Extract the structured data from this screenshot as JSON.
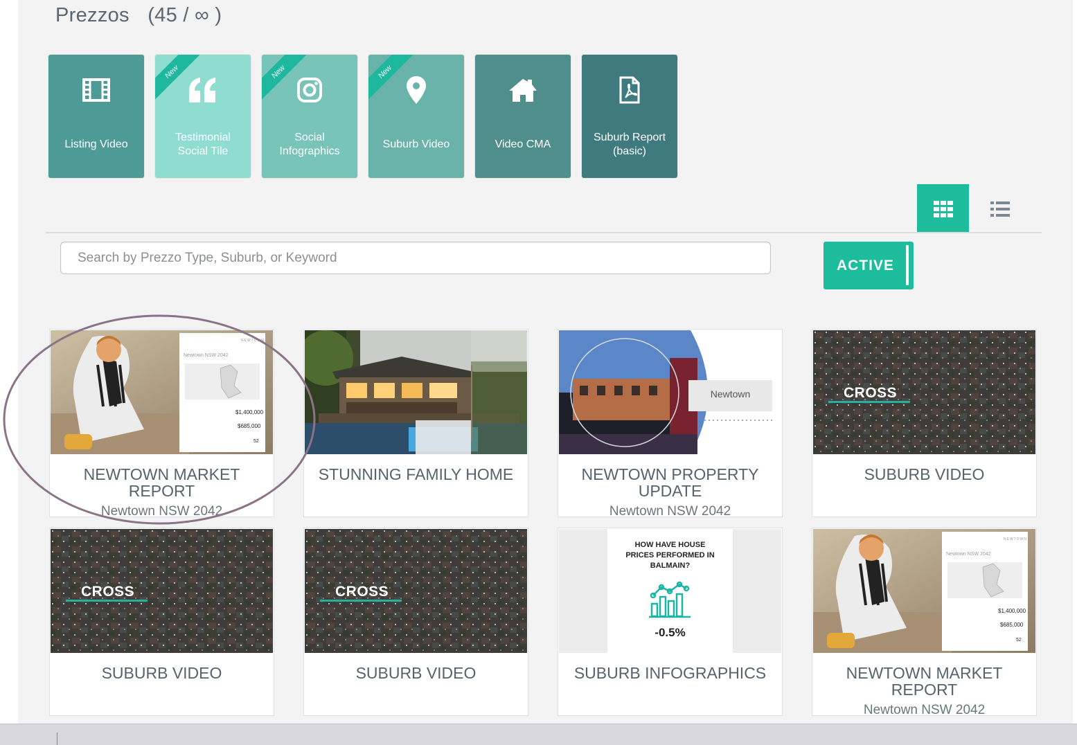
{
  "header": {
    "title": "Prezzos",
    "count": "(45 / ∞ )"
  },
  "create_tiles": [
    {
      "label": "Listing Video",
      "icon": "film-icon",
      "color": "#4e9a97",
      "is_new": false
    },
    {
      "label": "Testimonial Social Tile",
      "icon": "quote-icon",
      "color": "#8fddd1",
      "is_new": true
    },
    {
      "label": "Social Infographics",
      "icon": "instagram-icon",
      "color": "#78c4b9",
      "is_new": true
    },
    {
      "label": "Suburb Video",
      "icon": "map-pin-icon",
      "color": "#69b3ab",
      "is_new": true
    },
    {
      "label": "Video CMA",
      "icon": "home-icon",
      "color": "#4f8e8b",
      "is_new": false
    },
    {
      "label": "Suburb Report (basic)",
      "icon": "pdf-file-icon",
      "color": "#3f7b7e",
      "is_new": false
    }
  ],
  "ribbon_label": "New",
  "view_toggle": {
    "grid": "grid-view-icon",
    "list": "list-view-icon",
    "selected": "grid"
  },
  "search": {
    "placeholder": "Search by Prezzo Type, Suburb, or Keyword",
    "value": ""
  },
  "filter": {
    "label": "ACTIVE"
  },
  "accent_color": "#1cbc9c",
  "cards": [
    {
      "title": "NEWTOWN MARKET REPORT",
      "subtitle": "Newtown NSW 2042",
      "thumb": {
        "type": "market-report",
        "heading": "Newtown NSW 2042",
        "price1": "$1,400,000",
        "price2": "$685,000",
        "num": "52",
        "brand": "NEWTOWN"
      }
    },
    {
      "title": "STUNNING FAMILY HOME",
      "subtitle": "",
      "thumb": {
        "type": "house-photo"
      }
    },
    {
      "title": "NEWTOWN PROPERTY UPDATE",
      "subtitle": "Newtown NSW 2042",
      "thumb": {
        "type": "street-photo",
        "label": "Newtown"
      }
    },
    {
      "title": "SUBURB VIDEO",
      "subtitle": "",
      "thumb": {
        "type": "aerial",
        "label": "CROSS"
      }
    },
    {
      "title": "SUBURB VIDEO",
      "subtitle": "",
      "thumb": {
        "type": "aerial",
        "label": "CROSS"
      }
    },
    {
      "title": "SUBURB VIDEO",
      "subtitle": "",
      "thumb": {
        "type": "aerial",
        "label": "CROSS"
      }
    },
    {
      "title": "SUBURB INFOGRAPHICS",
      "subtitle": "",
      "thumb": {
        "type": "infographic",
        "heading": "HOW HAVE HOUSE PRICES PERFORMED IN BALMAIN?",
        "value": "-0.5%"
      }
    },
    {
      "title": "NEWTOWN MARKET REPORT",
      "subtitle": "Newtown NSW 2042",
      "thumb": {
        "type": "market-report",
        "heading": "Newtown NSW 2042",
        "price1": "$1,400,000",
        "price2": "$685,000",
        "num": "52",
        "brand": "NEWTOWN"
      }
    }
  ]
}
